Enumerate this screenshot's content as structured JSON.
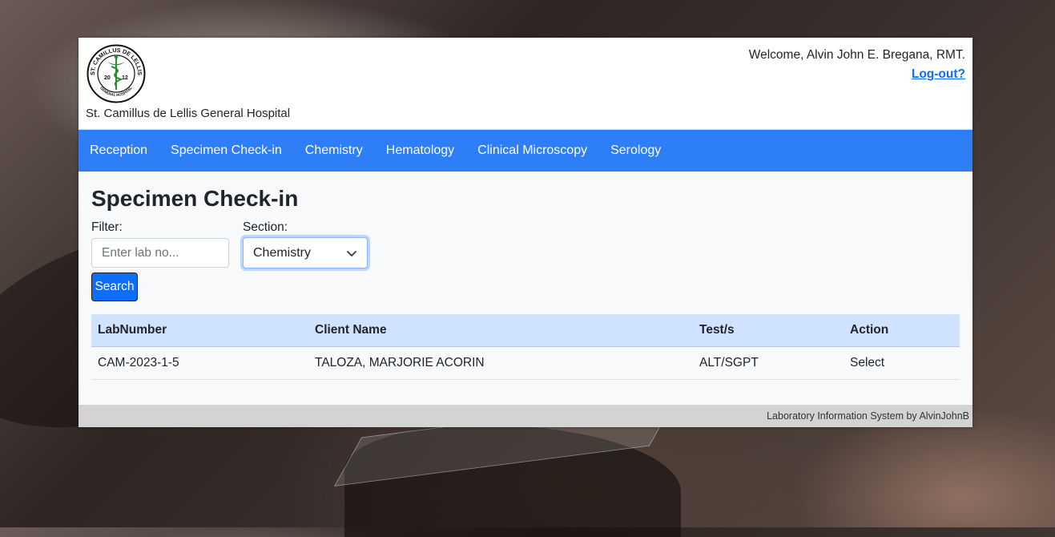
{
  "header": {
    "hospital_name": "St. Camillus de Lellis General Hospital",
    "logo_top_text": "ST. CAMILLUS DE LELLIS",
    "logo_bottom_text": "GENERAL HOSPITAL",
    "logo_year_left": "20",
    "logo_year_right": "12",
    "welcome_text": "Welcome, Alvin John E. Bregana, RMT.",
    "logout_label": "Log-out?"
  },
  "nav": {
    "items": [
      "Reception",
      "Specimen Check-in",
      "Chemistry",
      "Hematology",
      "Clinical Microscopy",
      "Serology"
    ]
  },
  "page": {
    "title": "Specimen Check-in",
    "filter_label": "Filter:",
    "filter_placeholder": "Enter lab no...",
    "section_label": "Section:",
    "section_selected": "Chemistry",
    "search_label": "Search"
  },
  "table": {
    "columns": [
      "LabNumber",
      "Client Name",
      "Test/s",
      "Action"
    ],
    "rows": [
      [
        "CAM-2023-1-5",
        "TALOZA, MARJORIE ACORIN",
        "ALT/SGPT",
        "Select"
      ]
    ]
  },
  "footer": {
    "text": "Laboratory Information System by AlvinJohnB"
  },
  "colors": {
    "navbar": "#2d7ef7",
    "table_header": "#cfe2ff",
    "primary": "#0d6efd",
    "footer": "#d3d3d3"
  }
}
